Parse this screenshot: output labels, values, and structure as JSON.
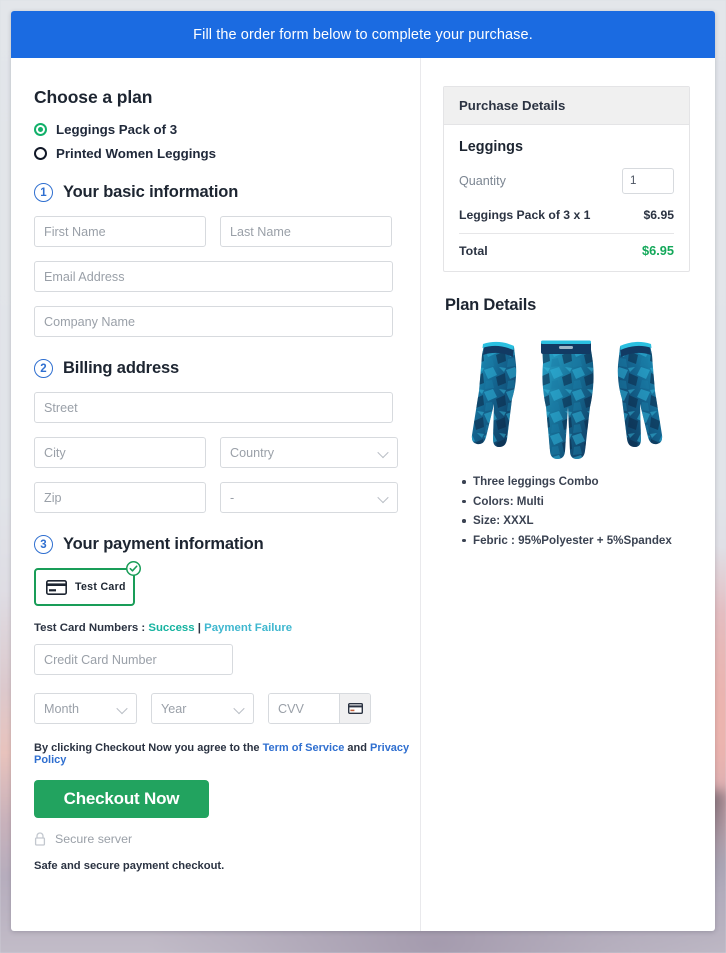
{
  "banner": {
    "message": "Fill the order form below to complete your purchase."
  },
  "plan": {
    "heading": "Choose a plan",
    "options": [
      {
        "label": "Leggings Pack of 3",
        "selected": true
      },
      {
        "label": "Printed Women Leggings",
        "selected": false
      }
    ]
  },
  "steps": {
    "basic": {
      "number": "1",
      "title": "Your basic information"
    },
    "billing": {
      "number": "2",
      "title": "Billing address"
    },
    "payment": {
      "number": "3",
      "title": "Your payment information"
    }
  },
  "fields": {
    "first_name": "First Name",
    "last_name": "Last Name",
    "email": "Email Address",
    "company": "Company Name",
    "street": "Street",
    "city": "City",
    "country": "Country",
    "zip": "Zip",
    "state": "-",
    "credit_card": "Credit Card Number",
    "month": "Month",
    "year": "Year",
    "cvv": "CVV"
  },
  "payment": {
    "test_card_label": "Test  Card",
    "test_numbers_prefix": "Test Card Numbers : ",
    "success_link": "Success",
    "separator": " | ",
    "failure_link": "Payment Failure"
  },
  "terms": {
    "prefix": "By clicking Checkout Now you agree to the ",
    "tos": "Term of Service",
    "middle": " and ",
    "privacy": "Privacy Policy"
  },
  "actions": {
    "checkout": "Checkout Now",
    "secure_server": "Secure server",
    "safe_note": "Safe and secure payment checkout."
  },
  "purchase": {
    "header": "Purchase Details",
    "product": "Leggings",
    "quantity_label": "Quantity",
    "quantity_value": "1",
    "line_item": "Leggings Pack of 3 x 1",
    "line_price": "$6.95",
    "total_label": "Total",
    "total_value": "$6.95"
  },
  "plan_details": {
    "heading": "Plan Details",
    "specs": [
      "Three leggings Combo",
      "Colors: Multi",
      "Size: XXXL",
      "Febric : 95%Polyester + 5%Spandex"
    ]
  },
  "colors": {
    "banner_blue": "#1b6be1",
    "accent_green": "#22a35f",
    "total_green": "#14a85a",
    "step_blue": "#2f6fd0",
    "link_teal": "#16b3a0",
    "link_cyan": "#3fb7cf"
  }
}
